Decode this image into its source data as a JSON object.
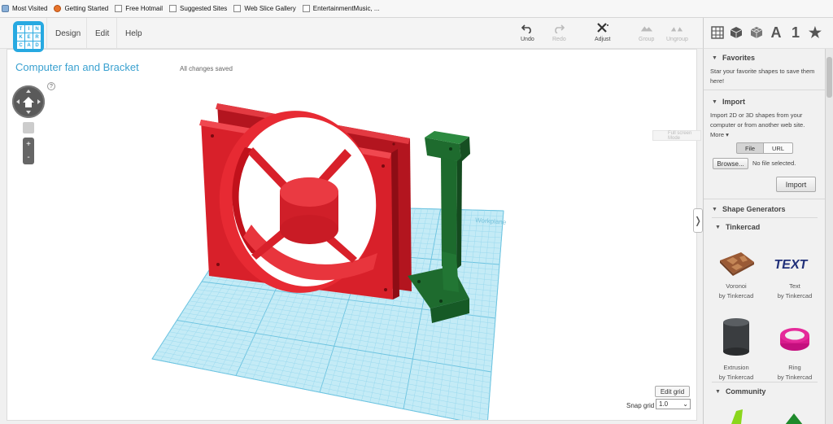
{
  "browser": {
    "bookmarks": [
      {
        "label": "Most Visited",
        "icon": "gear-icon"
      },
      {
        "label": "Getting Started",
        "icon": "firefox-icon"
      },
      {
        "label": "Free Hotmail",
        "icon": "page-icon"
      },
      {
        "label": "Suggested Sites",
        "icon": "page-icon"
      },
      {
        "label": "Web Slice Gallery",
        "icon": "page-icon"
      },
      {
        "label": "EntertainmentMusic, ...",
        "icon": "page-icon"
      }
    ]
  },
  "app": {
    "logo": [
      "TIN",
      "KER",
      "CAD"
    ],
    "menu": [
      "Design",
      "Edit",
      "Help"
    ],
    "tools": {
      "undo": "Undo",
      "redo": "Redo",
      "adjust": "Adjust",
      "group": "Group",
      "ungroup": "Ungroup"
    },
    "view_icons": [
      "grid-view-icon",
      "box-icon",
      "wireframe-box-icon",
      "text-icon",
      "number-icon",
      "star-icon"
    ],
    "view_text_icon": "A",
    "view_number_icon": "1",
    "view_star_icon": "★"
  },
  "canvas": {
    "title": "Computer fan and Bracket",
    "status": "All changes saved",
    "help": "?",
    "zoom_in": "+",
    "zoom_out": "-",
    "workplane_label": "Workplane",
    "edit_grid": "Edit grid",
    "snap_grid_label": "Snap grid",
    "snap_grid_value": "1.0",
    "fullscreen_hint": "Full screen Mode"
  },
  "panel": {
    "favorites": {
      "heading": "Favorites",
      "text": "Star your favorite shapes to save them here!"
    },
    "import": {
      "heading": "Import",
      "text": "Import 2D or 3D shapes from your computer or from another web site.",
      "more": "More",
      "tab_file": "File",
      "tab_url": "URL",
      "browse": "Browse...",
      "no_file": "No file selected.",
      "import_button": "Import"
    },
    "shape_generators": {
      "heading": "Shape Generators",
      "tinkercad_heading": "Tinkercad",
      "shapes": [
        {
          "name": "Voronoi",
          "by": "by Tinkercad"
        },
        {
          "name": "Text",
          "by": "by Tinkercad"
        },
        {
          "name": "Extrusion",
          "by": "by Tinkercad"
        },
        {
          "name": "Ring",
          "by": "by Tinkercad"
        }
      ],
      "community_heading": "Community"
    }
  },
  "colors": {
    "accent": "#27a9e1",
    "fan": "#d8202a",
    "bracket": "#1e6b2e",
    "workplane": "#bfe9f5"
  }
}
